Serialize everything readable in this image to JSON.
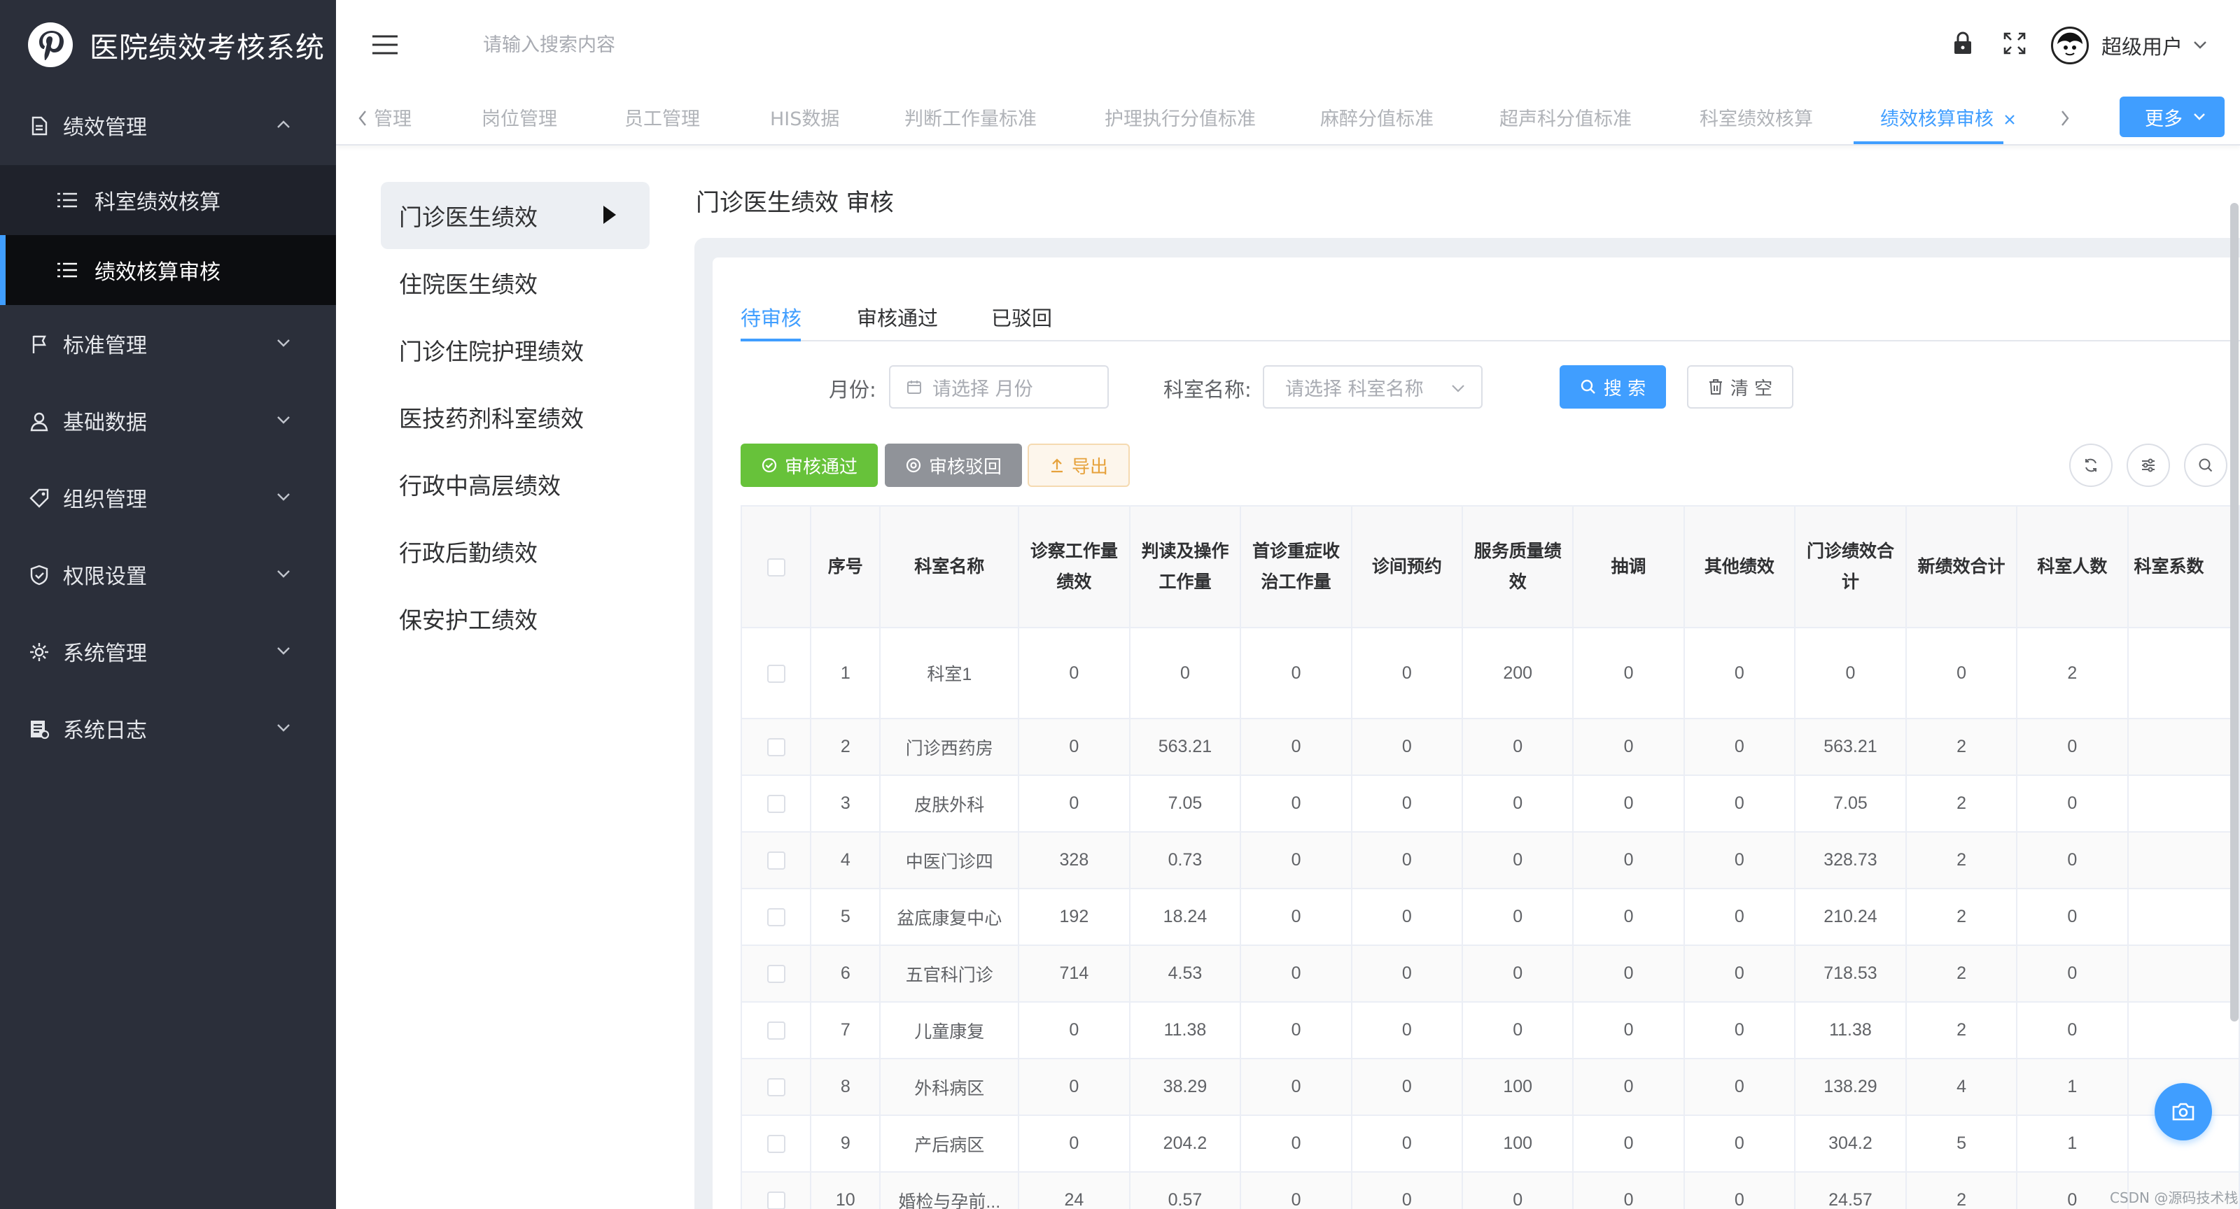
{
  "app": {
    "title": "医院绩效考核系统"
  },
  "sidebar": {
    "menus": [
      {
        "label": "绩效管理",
        "icon": "document-icon",
        "expanded": true
      },
      {
        "label": "标准管理",
        "icon": "flag-icon"
      },
      {
        "label": "基础数据",
        "icon": "user-icon"
      },
      {
        "label": "组织管理",
        "icon": "tag-icon"
      },
      {
        "label": "权限设置",
        "icon": "shield-icon"
      },
      {
        "label": "系统管理",
        "icon": "gear-icon"
      },
      {
        "label": "系统日志",
        "icon": "log-icon"
      }
    ],
    "submenus": [
      {
        "label": "科室绩效核算",
        "active": false
      },
      {
        "label": "绩效核算审核",
        "active": true
      }
    ]
  },
  "header": {
    "search_placeholder": "请输入搜索内容",
    "username": "超级用户"
  },
  "tags": {
    "items": [
      "管理",
      "岗位管理",
      "员工管理",
      "HIS数据",
      "判断工作量标准",
      "护理执行分值标准",
      "麻醉分值标准",
      "超声科分值标准",
      "科室绩效核算",
      "绩效核算审核"
    ],
    "active_index": 9,
    "more_label": "更多"
  },
  "sublist": {
    "items": [
      "门诊医生绩效",
      "住院医生绩效",
      "门诊住院护理绩效",
      "医技药剂科室绩效",
      "行政中高层绩效",
      "行政后勤绩效",
      "保安护工绩效"
    ],
    "active_index": 0
  },
  "page": {
    "heading": "门诊医生绩效 审核",
    "tabs": [
      "待审核",
      "审核通过",
      "已驳回"
    ],
    "active_tab": 0
  },
  "filters": {
    "month_label": "月份:",
    "month_placeholder": "请选择 月份",
    "dept_label": "科室名称:",
    "dept_placeholder": "请选择 科室名称",
    "search_label": "搜 索",
    "clear_label": "清 空"
  },
  "actions": {
    "approve_label": "审核通过",
    "reject_label": "审核驳回",
    "export_label": "导出"
  },
  "table": {
    "columns": [
      "序号",
      "科室名称",
      "诊察工作量绩效",
      "判读及操作工作量",
      "首诊重症收治工作量",
      "诊间预约",
      "服务质量绩效",
      "抽调",
      "其他绩效",
      "门诊绩效合计",
      "新绩效合计",
      "科室人数",
      "科室系数"
    ],
    "rows": [
      [
        "1",
        "科室1",
        "0",
        "0",
        "0",
        "0",
        "200",
        "0",
        "0",
        "0",
        "0",
        "2",
        ""
      ],
      [
        "2",
        "门诊西药房",
        "0",
        "563.21",
        "0",
        "0",
        "0",
        "0",
        "0",
        "563.21",
        "2",
        "0",
        ""
      ],
      [
        "3",
        "皮肤外科",
        "0",
        "7.05",
        "0",
        "0",
        "0",
        "0",
        "0",
        "7.05",
        "2",
        "0",
        ""
      ],
      [
        "4",
        "中医门诊四",
        "328",
        "0.73",
        "0",
        "0",
        "0",
        "0",
        "0",
        "328.73",
        "2",
        "0",
        ""
      ],
      [
        "5",
        "盆底康复中心",
        "192",
        "18.24",
        "0",
        "0",
        "0",
        "0",
        "0",
        "210.24",
        "2",
        "0",
        ""
      ],
      [
        "6",
        "五官科门诊",
        "714",
        "4.53",
        "0",
        "0",
        "0",
        "0",
        "0",
        "718.53",
        "2",
        "0",
        ""
      ],
      [
        "7",
        "儿童康复",
        "0",
        "11.38",
        "0",
        "0",
        "0",
        "0",
        "0",
        "11.38",
        "2",
        "0",
        ""
      ],
      [
        "8",
        "外科病区",
        "0",
        "38.29",
        "0",
        "0",
        "100",
        "0",
        "0",
        "138.29",
        "4",
        "1",
        ""
      ],
      [
        "9",
        "产后病区",
        "0",
        "204.2",
        "0",
        "0",
        "100",
        "0",
        "0",
        "304.2",
        "5",
        "1",
        ""
      ],
      [
        "10",
        "婚检与孕前...",
        "24",
        "0.57",
        "0",
        "0",
        "0",
        "0",
        "0",
        "24.57",
        "2",
        "0",
        ""
      ]
    ]
  },
  "watermark": "CSDN @源码技术栈",
  "colors": {
    "primary": "#409eff",
    "sidebar_bg": "#2b2f3a",
    "success": "#67c23a",
    "info": "#909399",
    "warning": "#e6a23c"
  }
}
